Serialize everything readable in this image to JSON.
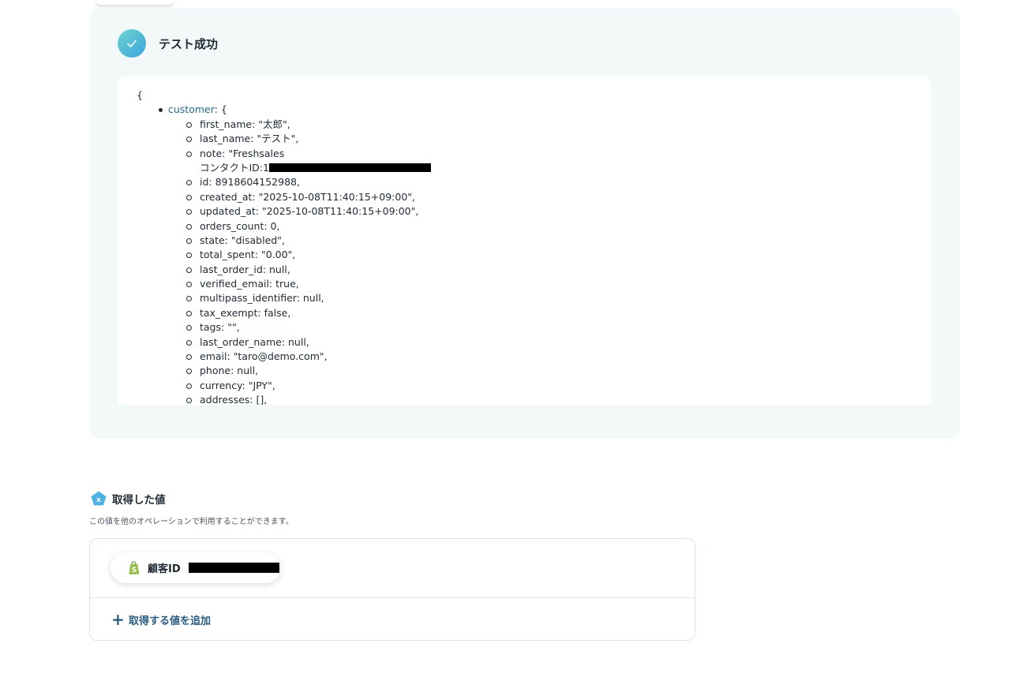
{
  "result": {
    "title": "テスト成功",
    "json_open": "{",
    "customer_key": "customer",
    "customer_open": ": {",
    "fields": [
      "first_name: \"太郎\",",
      "last_name: \"テスト\",",
      "note: \"Freshsales",
      "コンタクトID:1",
      "id: 8918604152988,",
      "created_at: \"2025-10-08T11:40:15+09:00\",",
      "updated_at: \"2025-10-08T11:40:15+09:00\",",
      "orders_count: 0,",
      "state: \"disabled\",",
      "total_spent: \"0.00\",",
      "last_order_id: null,",
      "verified_email: true,",
      "multipass_identifier: null,",
      "tax_exempt: false,",
      "tags: \"\",",
      "last_order_name: null,",
      "email: \"taro@demo.com\",",
      "phone: null,",
      "currency: \"JPY\",",
      "addresses: [],"
    ]
  },
  "acquired": {
    "title": "取得した値",
    "description": "この値を他のオペレーションで利用することができます。",
    "chip_label": "顧客ID",
    "add_label": "取得する値を追加",
    "add_icon": "+"
  },
  "icons": {
    "check": "check-icon",
    "variable": "variable-icon",
    "shopify": "shopify-icon"
  },
  "colors": {
    "accent": "#2b5d80",
    "panel_bg": "#f3f8f8",
    "check_gradient_start": "#6fd2cc",
    "check_gradient_end": "#3aa5df",
    "key_blue": "#2b6a8e"
  }
}
